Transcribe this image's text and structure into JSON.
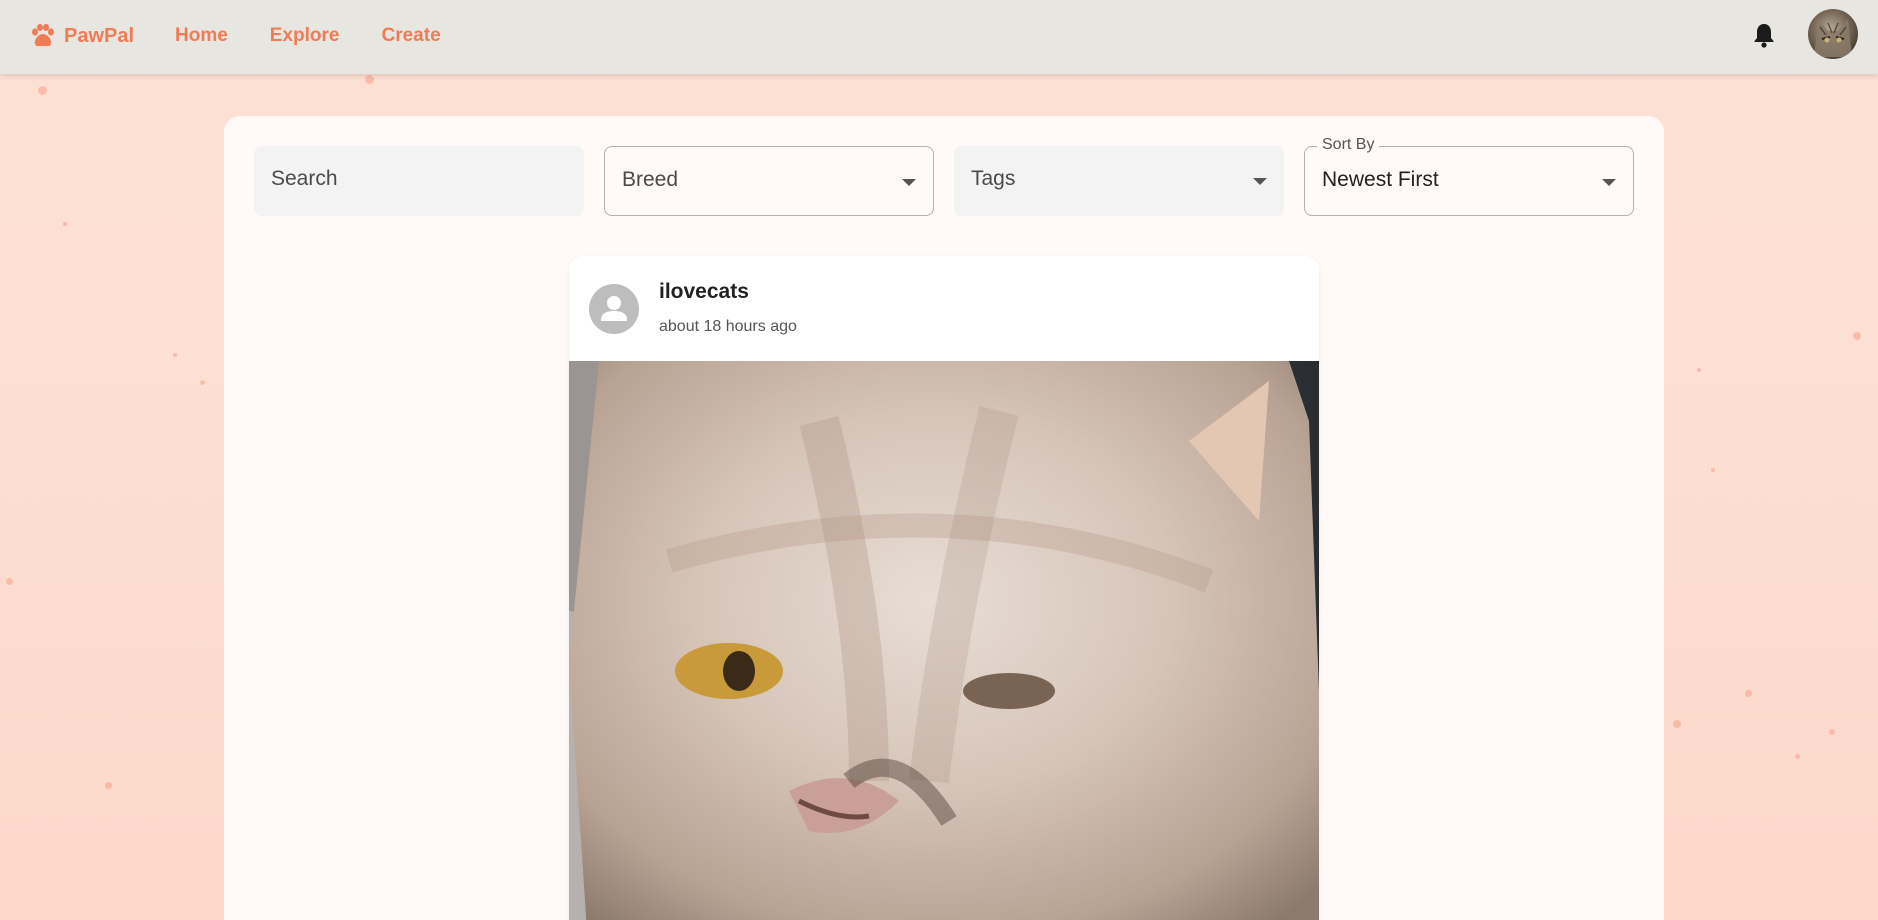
{
  "app": {
    "name": "PawPal",
    "accent_color": "#f07c55"
  },
  "nav": {
    "items": [
      {
        "label": "Home"
      },
      {
        "label": "Explore"
      },
      {
        "label": "Create"
      }
    ]
  },
  "header": {
    "notification_icon": "bell-icon",
    "avatar_icon": "user-avatar"
  },
  "filters": {
    "search": {
      "placeholder": "Search"
    },
    "breed": {
      "label": "Breed"
    },
    "tags": {
      "label": "Tags"
    },
    "sort": {
      "legend": "Sort By",
      "value": "Newest First"
    }
  },
  "feed": {
    "posts": [
      {
        "username": "ilovecats",
        "timestamp": "about 18 hours ago",
        "image_subject": "fluffy cream cat close-up"
      }
    ]
  }
}
